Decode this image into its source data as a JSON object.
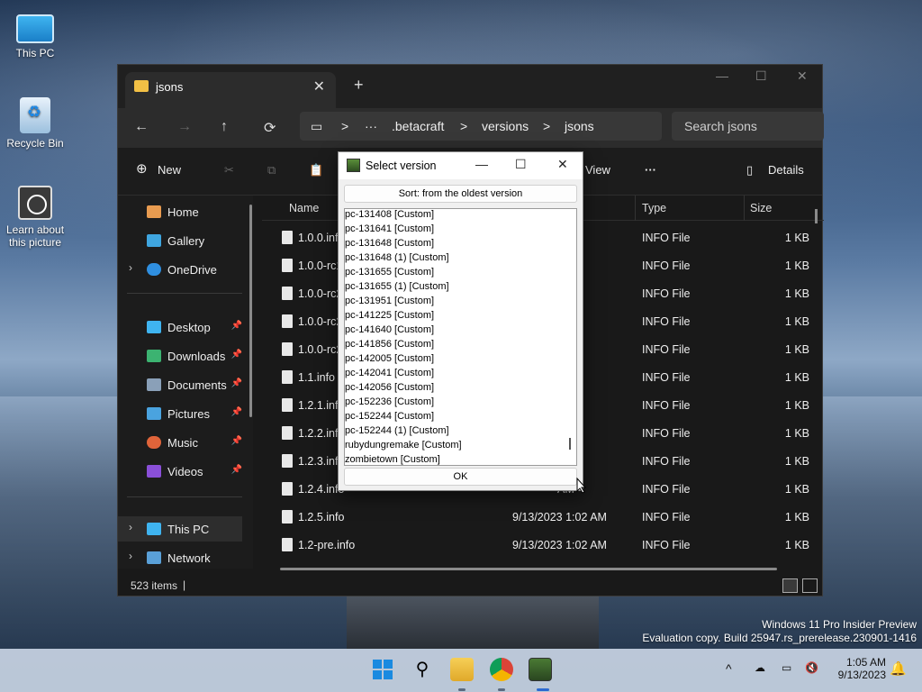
{
  "desktop": {
    "icons": [
      {
        "label": "This PC"
      },
      {
        "label": "Recycle Bin"
      },
      {
        "label": "Learn about this picture"
      }
    ],
    "watermark": {
      "line1": "Windows 11 Pro Insider Preview",
      "line2": "Evaluation copy. Build 25947.rs_prerelease.230901-1416"
    }
  },
  "explorer": {
    "tab_title": "jsons",
    "tab_close": "✕",
    "new_tab": "+",
    "window_controls": {
      "minimize": "—",
      "maximize": "☐",
      "close": "✕"
    },
    "nav_buttons": {
      "back": "←",
      "forward": "→",
      "up": "↑",
      "refresh": "⟳"
    },
    "breadcrumb": {
      "more": "···",
      "items": [
        ".betacraft",
        "versions",
        "jsons"
      ],
      "sep": ">"
    },
    "search_placeholder": "Search jsons",
    "commands": {
      "new": "New",
      "view": "View",
      "more": "···",
      "details": "Details"
    },
    "nav_pane": [
      {
        "label": "Home"
      },
      {
        "label": "Gallery"
      },
      {
        "label": "OneDrive"
      },
      {
        "label": "Desktop"
      },
      {
        "label": "Downloads"
      },
      {
        "label": "Documents"
      },
      {
        "label": "Pictures"
      },
      {
        "label": "Music"
      },
      {
        "label": "Videos"
      },
      {
        "label": "This PC"
      },
      {
        "label": "Network"
      }
    ],
    "columns": {
      "name": "Name",
      "type": "Type",
      "size": "Size"
    },
    "files": [
      {
        "name": "1.0.0.info",
        "date": "",
        "date_tail": "AM",
        "type": "INFO File",
        "size": "1 KB"
      },
      {
        "name": "1.0.0-rc1.",
        "date": "",
        "date_tail": "AM",
        "type": "INFO File",
        "size": "1 KB"
      },
      {
        "name": "1.0.0-rc2-",
        "date": "",
        "date_tail": "AM",
        "type": "INFO File",
        "size": "1 KB"
      },
      {
        "name": "1.0.0-rc2-",
        "date": "",
        "date_tail": "AM",
        "type": "INFO File",
        "size": "1 KB"
      },
      {
        "name": "1.0.0-rc2-",
        "date": "",
        "date_tail": "AM",
        "type": "INFO File",
        "size": "1 KB"
      },
      {
        "name": "1.1.info",
        "date": "",
        "date_tail": "AM",
        "type": "INFO File",
        "size": "1 KB"
      },
      {
        "name": "1.2.1.info",
        "date": "",
        "date_tail": "AM",
        "type": "INFO File",
        "size": "1 KB"
      },
      {
        "name": "1.2.2.info",
        "date": "",
        "date_tail": "AM",
        "type": "INFO File",
        "size": "1 KB"
      },
      {
        "name": "1.2.3.info",
        "date": "",
        "date_tail": "AM",
        "type": "INFO File",
        "size": "1 KB"
      },
      {
        "name": "1.2.4.info",
        "date": "",
        "date_tail": "AM",
        "type": "INFO File",
        "size": "1 KB"
      },
      {
        "name": "1.2.5.info",
        "date": "9/13/2023 1:02 AM",
        "date_tail": "",
        "type": "INFO File",
        "size": "1 KB"
      },
      {
        "name": "1.2-pre.info",
        "date": "9/13/2023 1:02 AM",
        "date_tail": "",
        "type": "INFO File",
        "size": "1 KB"
      }
    ],
    "status": "523 items"
  },
  "dialog": {
    "title": "Select version",
    "controls": {
      "minimize": "—",
      "maximize": "☐",
      "close": "✕"
    },
    "sort_label": "Sort: from the oldest version",
    "items": [
      "pc-131408 [Custom]",
      "pc-131641 [Custom]",
      "pc-131648 [Custom]",
      "pc-131648 (1) [Custom]",
      "pc-131655 [Custom]",
      "pc-131655 (1) [Custom]",
      "pc-131951 [Custom]",
      "pc-141225 [Custom]",
      "pc-141640 [Custom]",
      "pc-141856 [Custom]",
      "pc-142005 [Custom]",
      "pc-142041 [Custom]",
      "pc-142056 [Custom]",
      "pc-152236 [Custom]",
      "pc-152244 [Custom]",
      "pc-152244 (1) [Custom]",
      "rubydungremake [Custom]",
      "zombietown [Custom]"
    ],
    "ok_label": "OK"
  },
  "taskbar": {
    "clock_time": "1:05 AM",
    "clock_date": "9/13/2023",
    "tray_chevron": "^"
  },
  "colors": {
    "accent": "#0078d4",
    "folder": "#f2c045",
    "dark_bg": "#191919"
  }
}
